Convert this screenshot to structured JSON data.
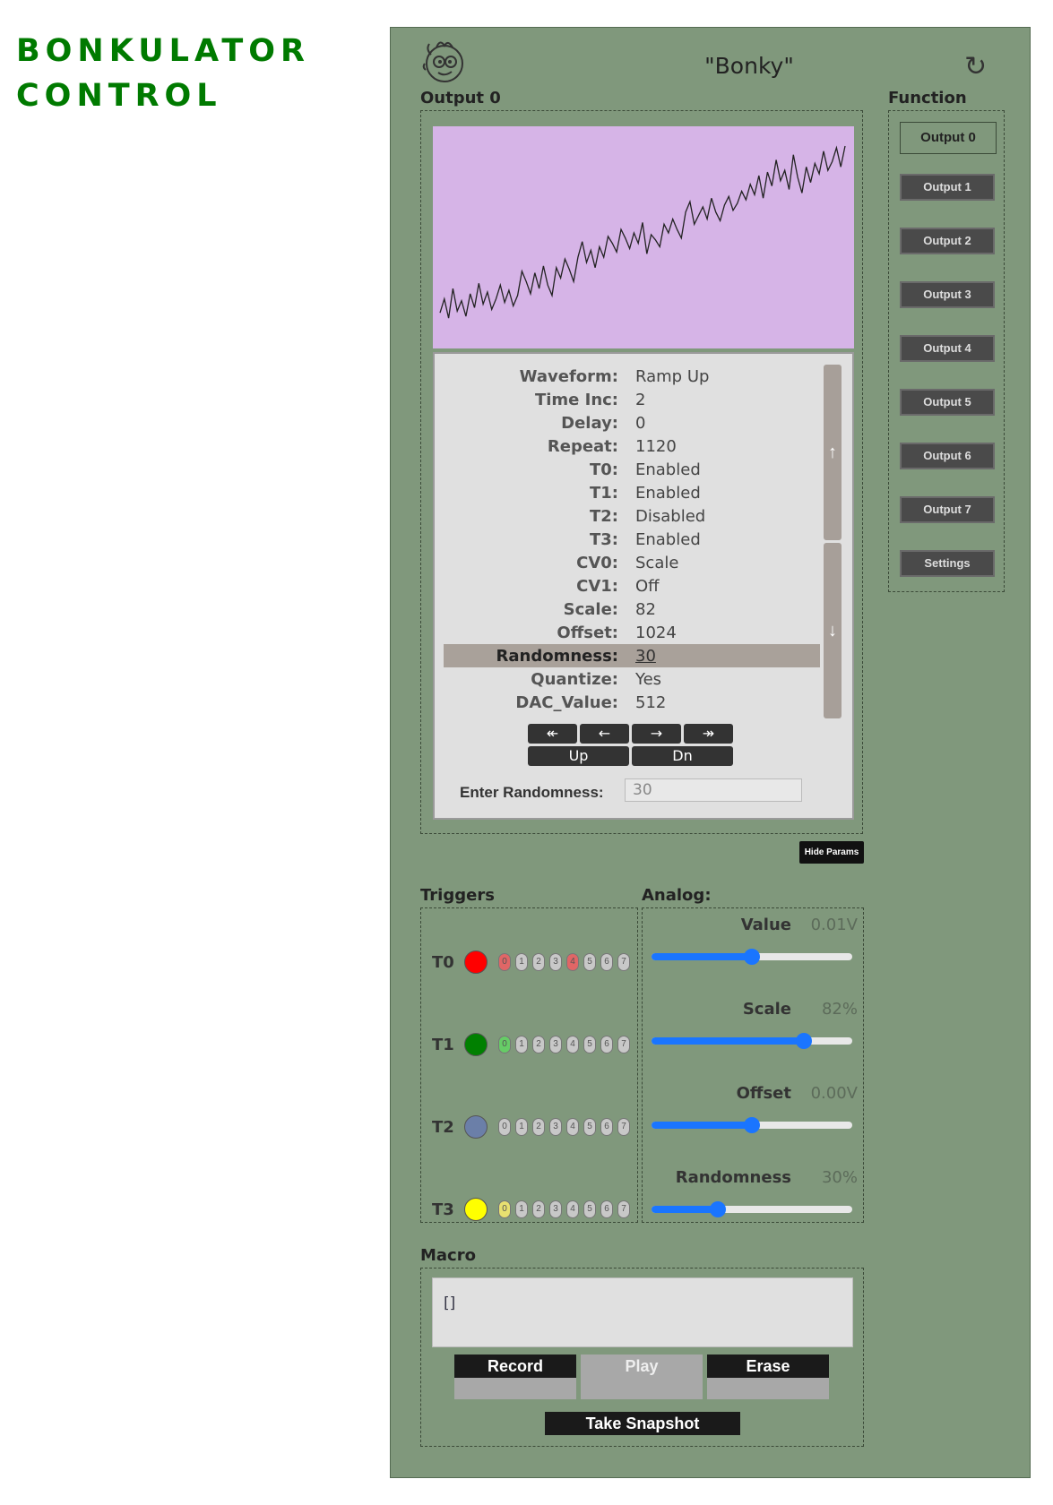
{
  "app": {
    "title_line1": "BONKULATOR",
    "title_line2": "CONTROL"
  },
  "header": {
    "device_name": "\"Bonky\"",
    "refresh_icon": "refresh-icon",
    "logo_icon": "bonky-face-logo"
  },
  "output": {
    "label": "Output 0",
    "waveform_plot": {
      "type": "line",
      "y": [
        0.04,
        0.12,
        0.01,
        0.18,
        0.05,
        0.11,
        0.02,
        0.15,
        0.07,
        0.21,
        0.09,
        0.16,
        0.06,
        0.12,
        0.2,
        0.1,
        0.17,
        0.08,
        0.14,
        0.28,
        0.22,
        0.15,
        0.27,
        0.18,
        0.31,
        0.2,
        0.14,
        0.3,
        0.24,
        0.35,
        0.29,
        0.22,
        0.36,
        0.45,
        0.33,
        0.4,
        0.3,
        0.42,
        0.36,
        0.48,
        0.44,
        0.39,
        0.52,
        0.47,
        0.41,
        0.5,
        0.44,
        0.56,
        0.38,
        0.49,
        0.46,
        0.42,
        0.55,
        0.5,
        0.58,
        0.52,
        0.47,
        0.62,
        0.68,
        0.55,
        0.6,
        0.65,
        0.58,
        0.7,
        0.62,
        0.57,
        0.66,
        0.71,
        0.63,
        0.67,
        0.74,
        0.69,
        0.78,
        0.72,
        0.83,
        0.7,
        0.85,
        0.77,
        0.92,
        0.8,
        0.86,
        0.75,
        0.95,
        0.82,
        0.73,
        0.88,
        0.79,
        0.9,
        0.84,
        0.97,
        0.86,
        0.91,
        0.99,
        0.88,
        1.0
      ]
    }
  },
  "params": {
    "rows": [
      {
        "key": "Waveform:",
        "value": "Ramp Up"
      },
      {
        "key": "Time Inc:",
        "value": "2"
      },
      {
        "key": "Delay:",
        "value": "0"
      },
      {
        "key": "Repeat:",
        "value": "1120"
      },
      {
        "key": "T0:",
        "value": "Enabled"
      },
      {
        "key": "T1:",
        "value": "Enabled"
      },
      {
        "key": "T2:",
        "value": "Disabled"
      },
      {
        "key": "T3:",
        "value": "Enabled"
      },
      {
        "key": "CV0:",
        "value": "Scale"
      },
      {
        "key": "CV1:",
        "value": "Off"
      },
      {
        "key": "Scale:",
        "value": "82"
      },
      {
        "key": "Offset:",
        "value": "1024"
      },
      {
        "key": "Randomness:",
        "value": "30"
      },
      {
        "key": "Quantize:",
        "value": "Yes"
      },
      {
        "key": "DAC_Value:",
        "value": "512"
      }
    ],
    "selected_row": "Randomness:",
    "scroll_up": "↑",
    "scroll_down": "↓",
    "nav": {
      "first": "↞",
      "prev": "←",
      "next": "→",
      "last": "↠",
      "up": "Up",
      "dn": "Dn"
    },
    "enter_label": "Enter Randomness:",
    "enter_value": "30",
    "hide_button": "Hide Params"
  },
  "function": {
    "label": "Function",
    "items": [
      "Output 0",
      "Output 1",
      "Output 2",
      "Output 3",
      "Output 4",
      "Output 5",
      "Output 6",
      "Output 7",
      "Settings"
    ],
    "active": "Output 0"
  },
  "triggers": {
    "label": "Triggers",
    "rows": [
      {
        "name": "T0",
        "color": "#ff0000",
        "active_pills": [
          "0",
          "4"
        ],
        "pill_color": "#e06666"
      },
      {
        "name": "T1",
        "color": "#008000",
        "active_pills": [
          "0"
        ],
        "pill_color": "#66cc66"
      },
      {
        "name": "T2",
        "color": "#6b7fa8",
        "active_pills": [],
        "pill_color": "#c8c8c8"
      },
      {
        "name": "T3",
        "color": "#ffff00",
        "active_pills": [
          "0"
        ],
        "pill_color": "#e8e070"
      }
    ],
    "pill_labels": [
      "0",
      "1",
      "2",
      "3",
      "4",
      "5",
      "6",
      "7"
    ]
  },
  "analog": {
    "label": "Analog:",
    "controls": [
      {
        "label": "Value",
        "value": "0.01V",
        "level_pct": 50
      },
      {
        "label": "Scale",
        "value": "82%",
        "level_pct": 76
      },
      {
        "label": "Offset",
        "value": "0.00V",
        "level_pct": 50
      },
      {
        "label": "Randomness",
        "value": "30%",
        "level_pct": 33
      }
    ]
  },
  "macro": {
    "label": "Macro",
    "text": "[]",
    "record": "Record",
    "play": "Play",
    "erase": "Erase",
    "snapshot": "Take Snapshot"
  },
  "colors": {
    "panel_bg": "#80987c",
    "title_green": "#007a00",
    "wave_bg": "#d6b4e7",
    "slider_blue": "#1a75ff"
  }
}
